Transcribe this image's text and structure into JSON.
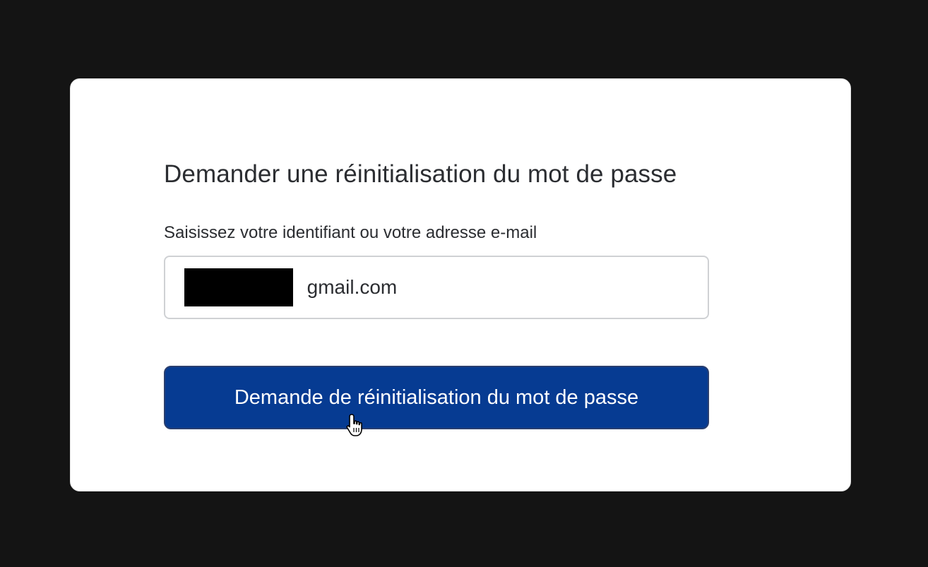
{
  "form": {
    "title": "Demander une réinitialisation du mot de passe",
    "field_label": "Saisissez votre identifiant ou votre adresse e-mail",
    "field_value_visible": "gmail.com",
    "submit_label": "Demande de réinitialisation du mot de passe"
  },
  "colors": {
    "backdrop": "#141414",
    "card": "#ffffff",
    "text": "#2b2d31",
    "button": "#063b92",
    "button_text": "#ffffff"
  },
  "icons": {
    "cursor": "hand-pointer-cursor-icon"
  }
}
